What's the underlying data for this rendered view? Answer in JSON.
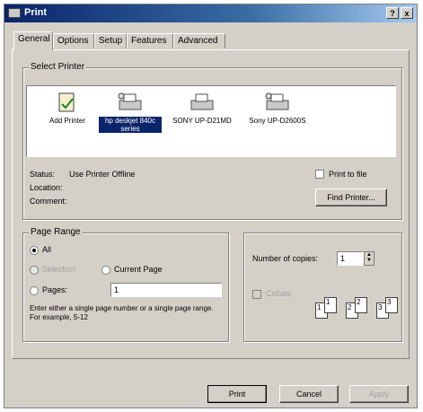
{
  "window": {
    "title": "Print",
    "help_btn": "?",
    "close_btn": "x"
  },
  "tabs": [
    "General",
    "Options",
    "Setup",
    "Features",
    "Advanced"
  ],
  "select_printer": {
    "group_label": "Select Printer",
    "printers": [
      {
        "label": "Add Printer",
        "icon": "add-printer-icon",
        "selected": false
      },
      {
        "label": "hp deskjet 840c series",
        "icon": "printer-icon",
        "selected": true
      },
      {
        "label": "SONY UP-D21MD",
        "icon": "printer-icon",
        "selected": false
      },
      {
        "label": "Sony UP-D2600S",
        "icon": "printer-icon",
        "selected": false
      }
    ],
    "status_label": "Status:",
    "status_value": "Use Printer Offline",
    "location_label": "Location:",
    "comment_label": "Comment:",
    "print_to_file": "Print to file",
    "find_printer": "Find Printer..."
  },
  "page_range": {
    "group_label": "Page Range",
    "all": "All",
    "selection": "Selection",
    "current_page": "Current Page",
    "pages": "Pages:",
    "pages_value": "1",
    "hint": "Enter either a single page number or a single page range.  For example, 5-12"
  },
  "copies": {
    "label": "Number of copies:",
    "value": "1",
    "collate": "Collate",
    "page_numbers": [
      "1",
      "1",
      "2",
      "2",
      "3",
      "3"
    ]
  },
  "buttons": {
    "print": "Print",
    "cancel": "Cancel",
    "apply": "Apply"
  },
  "colors": {
    "title_bar": "#0a246a",
    "selection": "#0a246a",
    "dialog_bg": "#d4d0c8"
  }
}
